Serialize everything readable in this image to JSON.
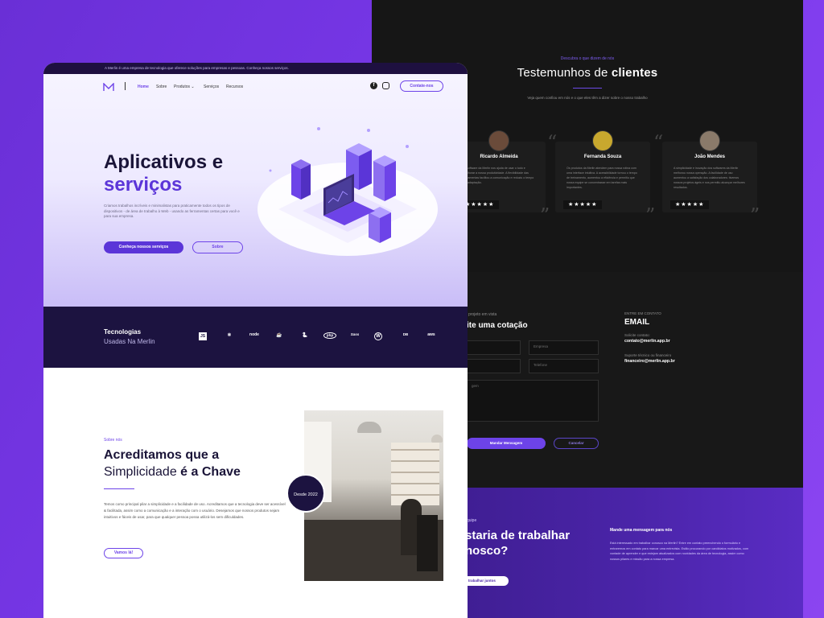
{
  "back": {
    "eyebrow": "Descubra o que dizem de nós",
    "title_light": "Testemunhos de",
    "title_bold": "clientes",
    "desc": "Veja quem confiou em nós e o que eles têm a dizer sobre o nosso trabalho",
    "testimonials": [
      {
        "name": "Ricardo Almeida",
        "text": "O software da Merlin nos ajuda de usar o tudo e melhorar a nossa produtividade. A flexibilidade das ferramentas facilitou a comunicação e reduziu o tempo de adaptação.",
        "stars": "★★★★★"
      },
      {
        "name": "Fernanda Souza",
        "text": "Os produtos da Merlin atendem para nossa rotina com uma interface intuitiva. A acessibilidade tornou o tempo de treinamento, aumentou a eficiência e permitiu que nossa equipe se concentrasse em tarefas mais importantes.",
        "stars": "★★★★★"
      },
      {
        "name": "João Mendes",
        "text": "A simplicidade e inovação dos softwares da Merlin melhorou nossa operação. A facilidade de uso aumentou a satisfação dos colaboradores: tivemos nossos projetos ágeis e nos permitiu alcançar melhores resultados.",
        "stars": "★★★★★"
      }
    ],
    "contact": {
      "proj_label": "projeto em vista",
      "heading": "ite uma cotação",
      "placeholders": [
        "",
        "Empresa",
        "",
        "Telefone",
        "gem"
      ],
      "send_btn": "Mandar Mensagem",
      "cancel_btn": "Cancelar",
      "info_eyebrow": "ENTRE EM CONTATO",
      "info_title": "EMAIL",
      "info_items": [
        {
          "label": "Solicite contato:",
          "value": "contato@merlin.app.br"
        },
        {
          "label": "Suporte técnico ou financeiro",
          "value": "financeiro@merlin.app.br"
        }
      ]
    },
    "cta": {
      "eyebrow": "quipe",
      "heading_line1": "staria de trabalhar",
      "heading_line2": "nosco?",
      "button": "s trabalhar juntos",
      "right_title": "Mande uma mensagem para nós",
      "right_text": "Está interessado em trabalhar conosco na Merlin? Entre em contato preenchendo o formulário e entraremos em contato para marcar uma entrevista. Estão procurando por candidatos motivados, com vontade de aprender e que estejam atualizados com novidades da área de tecnologia, assim como nossos pilares e missão para a nossa empresa."
    }
  },
  "front": {
    "announcement": "A Merlin é uma empresa de tecnologia que oferece soluções para empresas e pessoas. Conheça nossos serviços.",
    "nav": {
      "logo": "M",
      "links": [
        "Home",
        "Sobre",
        "Produtos",
        "Serviços",
        "Recursos"
      ],
      "cta": "Contate-nos"
    },
    "hero": {
      "title_line1": "Aplicativos e",
      "title_line2": "serviços",
      "text": "Criamos trabalhos incríveis e minimalistas para praticamente todos os tipos de dispositivos - de área de trabalho à Web - usando as ferramentas certas para você e para sua empresa.",
      "btn_primary": "Conheça nossos serviços",
      "btn_secondary": "Sobre"
    },
    "tech": {
      "title": "Tecnologias",
      "subtitle": "Usadas Na Merlin",
      "logos": [
        "JS",
        "⚛",
        "node",
        "☕",
        "🐍",
        "php",
        "Sass",
        "W",
        "DB",
        "aws"
      ]
    },
    "about": {
      "eyebrow": "Sobre nós",
      "title_line1": "Acreditamos que a",
      "title_light": "Simplicidade",
      "title_bold": "é a Chave",
      "text": "Temos como principal pilar a simplicidade e a facilidade de uso. Acreditamos que a tecnologia deve ser acessível & facilitada, assim como a comunicação e a interação com o usuário. Desejamos que nossos produtos sejam intuitivos e fáceis de usar, para que qualquer pessoa possa utilizá-los sem dificuldades.",
      "button": "Vamos lá!",
      "badge": "Desde 2022"
    }
  },
  "colors": {
    "accent": "#6d43e8",
    "dark": "#1c1340",
    "bg": "#7c3aed"
  }
}
